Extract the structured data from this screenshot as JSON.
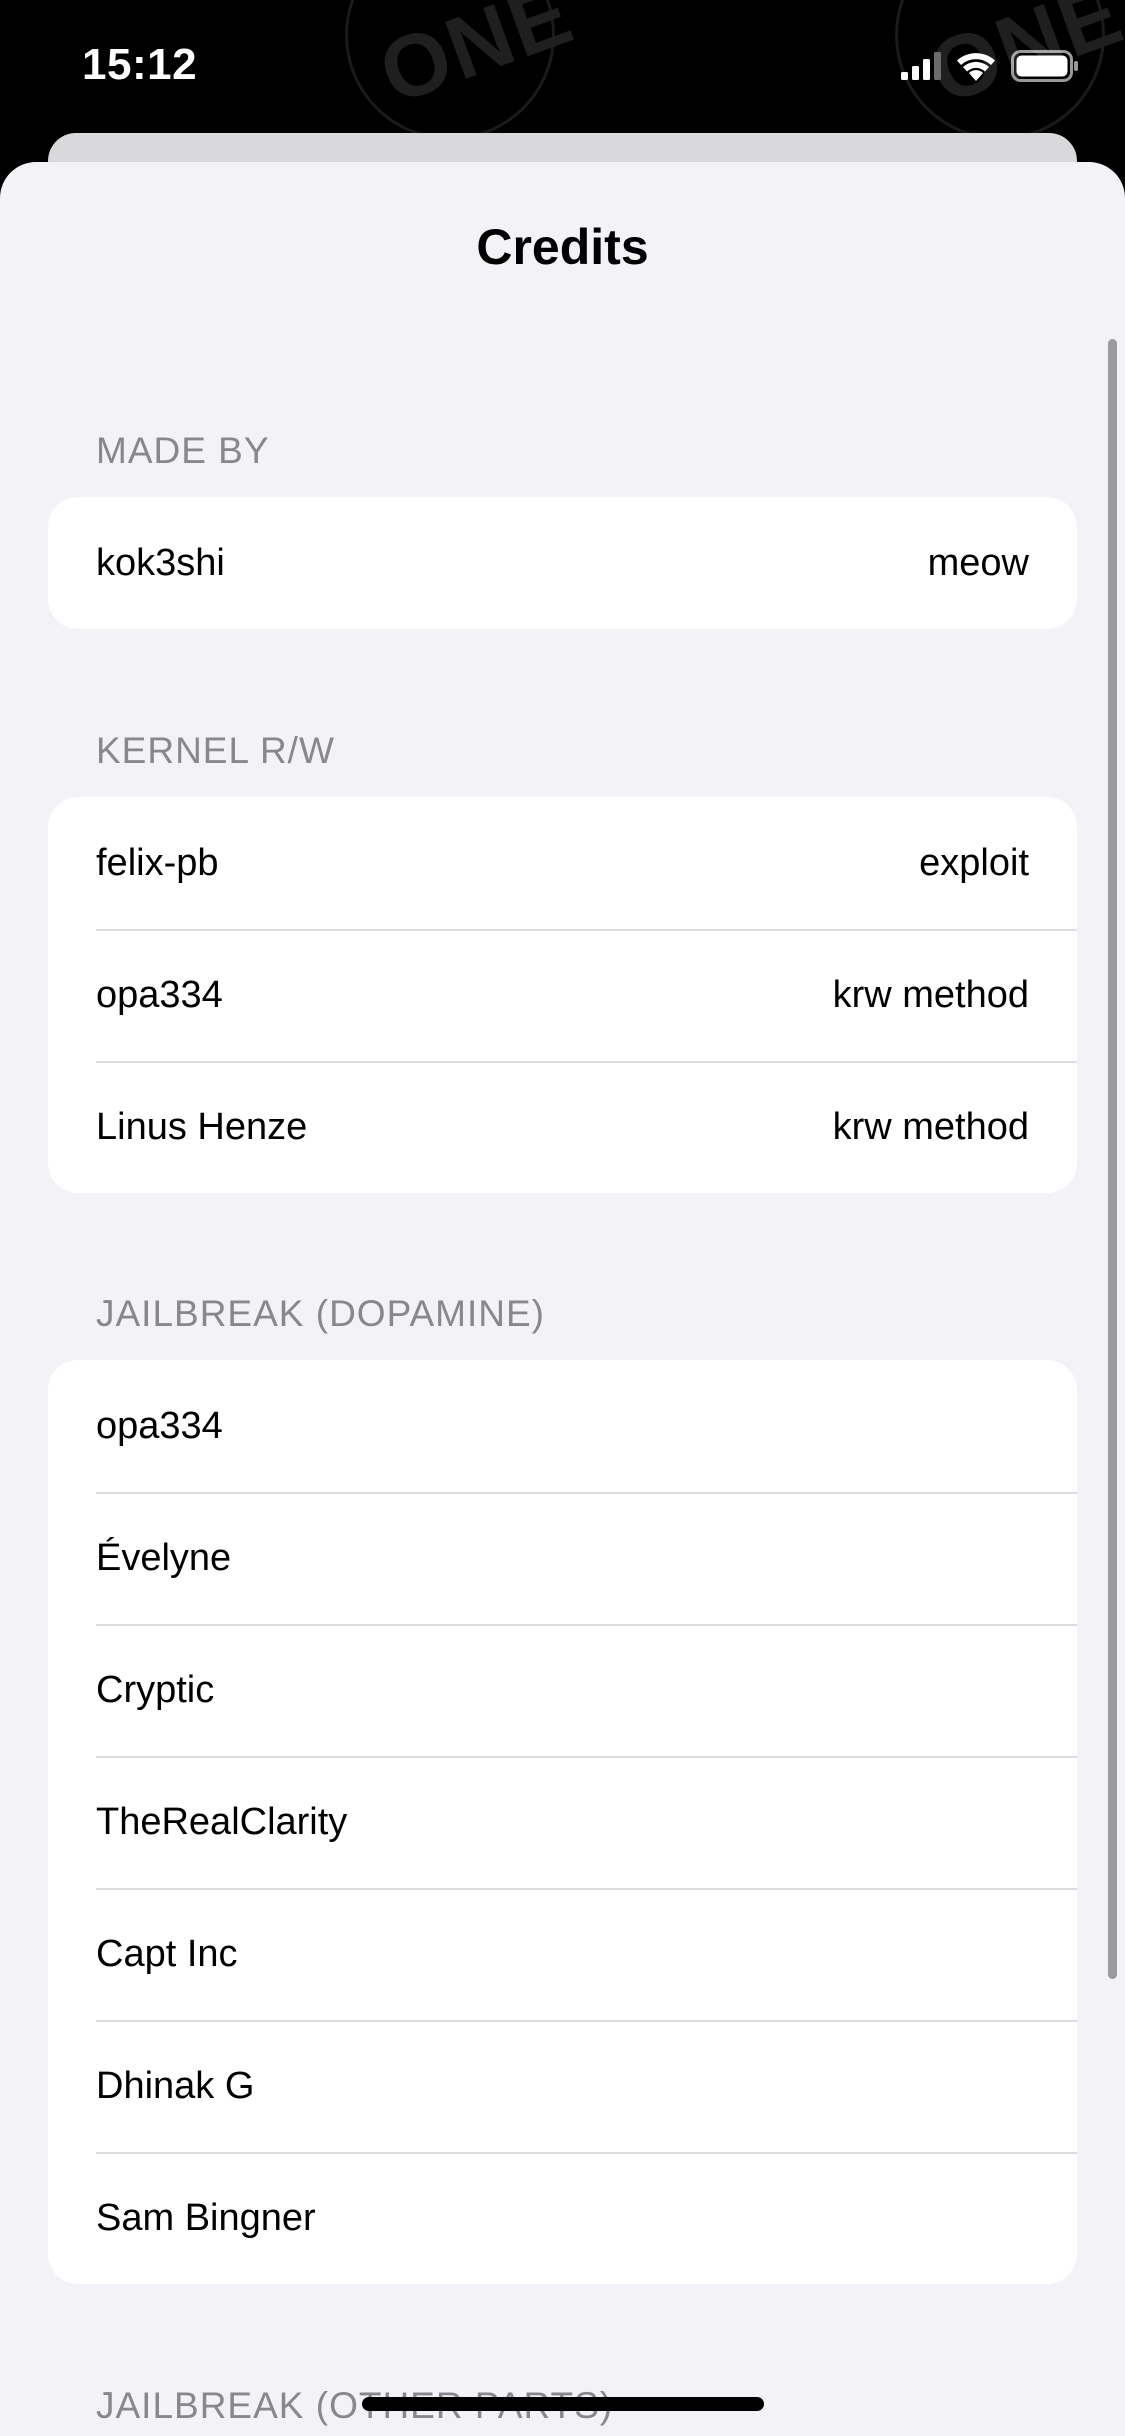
{
  "status_bar": {
    "time": "15:12",
    "signal_icon": "cellular-signal-icon",
    "wifi_icon": "wifi-icon",
    "battery_icon": "battery-icon"
  },
  "background": {
    "watermark_text": "ONE"
  },
  "sheet": {
    "title": "Credits"
  },
  "sections": {
    "made_by": {
      "header": "MADE BY",
      "rows": [
        {
          "name": "kok3shi",
          "value": "meow"
        }
      ]
    },
    "kernel_rw": {
      "header": "KERNEL R/W",
      "rows": [
        {
          "name": "felix-pb",
          "value": "exploit"
        },
        {
          "name": "opa334",
          "value": "krw method"
        },
        {
          "name": "Linus Henze",
          "value": "krw method"
        }
      ]
    },
    "jailbreak_dopamine": {
      "header": "JAILBREAK (DOPAMINE)",
      "rows": [
        {
          "name": "opa334"
        },
        {
          "name": "Évelyne"
        },
        {
          "name": "Cryptic"
        },
        {
          "name": "TheRealClarity"
        },
        {
          "name": "Capt Inc"
        },
        {
          "name": "Dhinak G"
        },
        {
          "name": "Sam Bingner"
        }
      ]
    },
    "jailbreak_other": {
      "header": "JAILBREAK (OTHER PARTS)"
    }
  },
  "colors": {
    "sheet_background": "#f2f2f7",
    "card_background": "#ffffff",
    "section_header": "#87878c",
    "separator": "#dcdce0"
  }
}
